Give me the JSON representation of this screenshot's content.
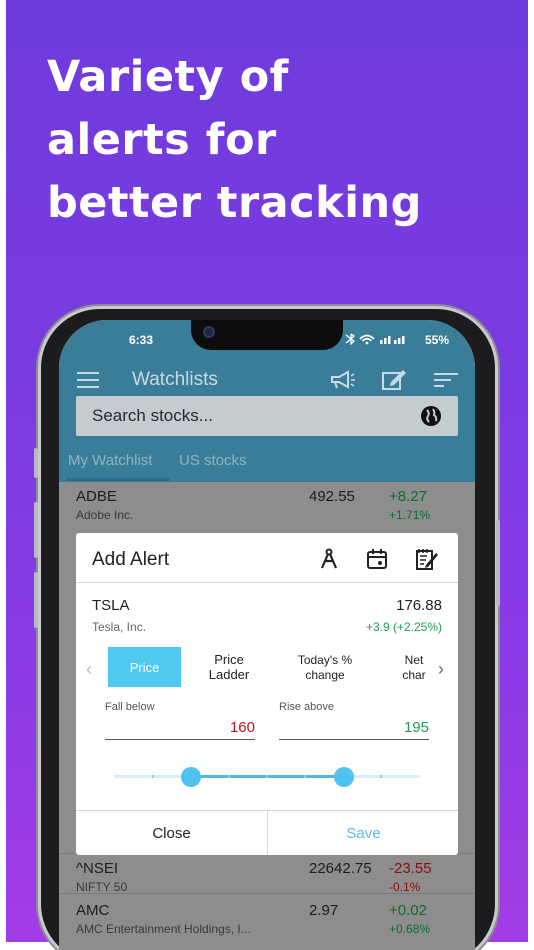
{
  "headline": [
    "Variety of",
    "alerts for",
    "better tracking"
  ],
  "status": {
    "time": "6:33",
    "battery": "55%"
  },
  "appbar": {
    "title": "Watchlists"
  },
  "search": {
    "placeholder": "Search stocks..."
  },
  "tabs": [
    "My Watchlist",
    "US stocks"
  ],
  "rows": [
    {
      "symbol": "ADBE",
      "name": "Adobe Inc.",
      "price": "492.55",
      "change": "+8.27",
      "pct": "+1.71%",
      "dir": "up"
    },
    {
      "symbol": "^NSEI",
      "name": "NIFTY 50",
      "price": "22642.75",
      "change": "-23.55",
      "pct": "-0.1%",
      "dir": "down"
    },
    {
      "symbol": "AMC",
      "name": "AMC Entertainment Holdings, I...",
      "price": "2.97",
      "change": "+0.02",
      "pct": "+0.68%",
      "dir": "up"
    }
  ],
  "dialog": {
    "title": "Add Alert",
    "stock": {
      "symbol": "TSLA",
      "name": "Tesla, Inc.",
      "price": "176.88",
      "change": "+3.9  (+2.25%)"
    },
    "alert_types": [
      "Price",
      "Price Ladder",
      "Today's % change",
      "Net char"
    ],
    "selected_type": "Price",
    "fall_below": {
      "label": "Fall below",
      "value": "160"
    },
    "rise_above": {
      "label": "Rise above",
      "value": "195"
    },
    "slider": {
      "low": 0.25,
      "high": 0.75
    },
    "close_label": "Close",
    "save_label": "Save"
  },
  "colors": {
    "accent": "#4fc8f2",
    "appbar": "#3a7d99",
    "promo": "#7a3be0",
    "positive": "#1f9c55",
    "negative": "#c0131a"
  },
  "icons": [
    "menu-icon",
    "megaphone-icon",
    "edit-icon",
    "sort-icon",
    "globe-icon",
    "compass-icon",
    "calendar-icon",
    "notes-icon",
    "chevron-left-icon",
    "chevron-right-icon"
  ]
}
